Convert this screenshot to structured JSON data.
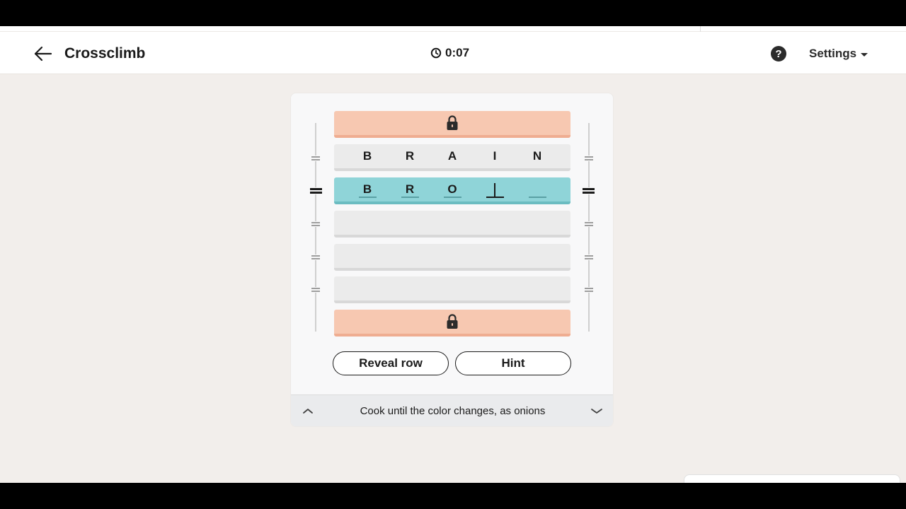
{
  "header": {
    "back_label": "Back",
    "title": "Crossclimb",
    "timer": "0:07",
    "help_label": "?",
    "settings_label": "Settings"
  },
  "puzzle": {
    "rows": [
      {
        "state": "locked",
        "icon": "lock-icon"
      },
      {
        "state": "filled",
        "letters": [
          "B",
          "R",
          "A",
          "I",
          "N"
        ]
      },
      {
        "state": "active",
        "letters": [
          "B",
          "R",
          "O",
          "",
          ""
        ],
        "cursor_index": 3
      },
      {
        "state": "empty"
      },
      {
        "state": "empty"
      },
      {
        "state": "empty"
      },
      {
        "state": "locked",
        "icon": "lock-icon"
      }
    ]
  },
  "buttons": {
    "reveal_row": "Reveal row",
    "hint": "Hint"
  },
  "clue": {
    "text": "Cook until the color changes, as onions"
  },
  "colors": {
    "locked_row": "#f7c8b1",
    "active_row": "#8fd4d8",
    "filled_row": "#ebebeb",
    "background": "#f2eeeb"
  }
}
